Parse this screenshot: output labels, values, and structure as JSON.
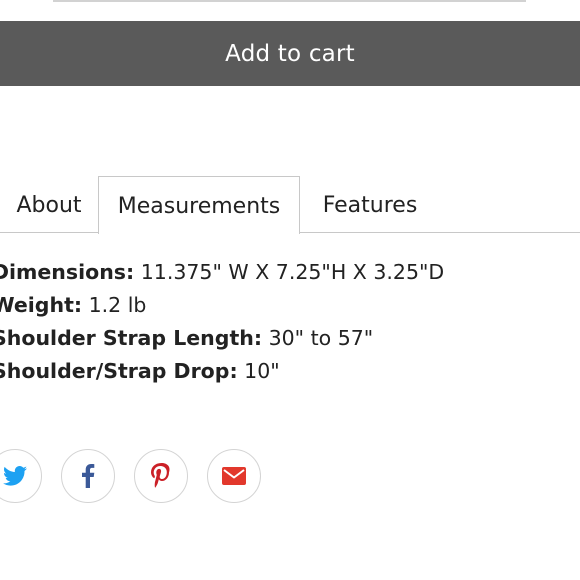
{
  "cart": {
    "add_label": "Add to cart"
  },
  "tabs": [
    {
      "label": "About"
    },
    {
      "label": "Measurements"
    },
    {
      "label": "Features"
    }
  ],
  "active_tab": "Measurements",
  "specs": [
    {
      "label": "Dimensions:",
      "value": "11.375\" W X 7.25\"H X 3.25\"D"
    },
    {
      "label": "Weight:",
      "value": "1.2 lb"
    },
    {
      "label": "Shoulder Strap Length:",
      "value": "30\" to 57\""
    },
    {
      "label": "Shoulder/Strap Drop:",
      "value": "10\""
    }
  ],
  "share": [
    {
      "icon": "twitter-icon",
      "color": "#1da1f2"
    },
    {
      "icon": "facebook-icon",
      "color": "#3b5998"
    },
    {
      "icon": "pinterest-icon",
      "color": "#cb2027"
    },
    {
      "icon": "email-icon",
      "color": "#e2382c"
    }
  ],
  "colors": {
    "button_bg": "#5a5a5a",
    "button_text": "#ffffff",
    "border": "#c8c8c8"
  }
}
